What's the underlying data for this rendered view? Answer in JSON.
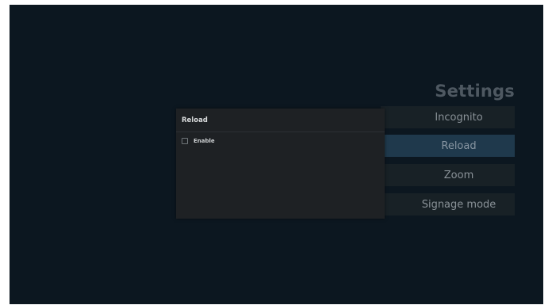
{
  "settings": {
    "title": "Settings",
    "menu": [
      {
        "label": "Incognito",
        "selected": false
      },
      {
        "label": "Reload",
        "selected": true
      },
      {
        "label": "Zoom",
        "selected": false
      },
      {
        "label": "Signage mode",
        "selected": false
      }
    ]
  },
  "dialog": {
    "title": "Reload",
    "option": {
      "label": "Enable",
      "checked": false
    }
  },
  "colors": {
    "background": "#0c1720",
    "menu_item": "#182126",
    "menu_item_selected": "#1f394c",
    "dialog": "#1e2124"
  }
}
